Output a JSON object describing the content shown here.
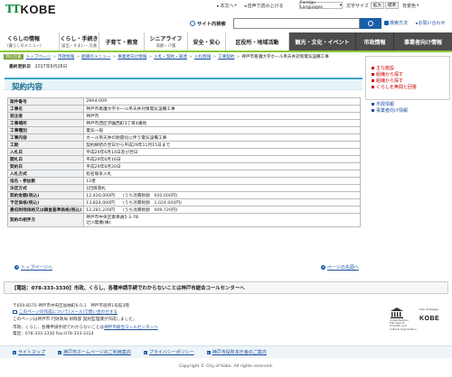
{
  "header": {
    "logo_mark": "TT",
    "logo_word": "KOBE",
    "links": {
      "home": "本文へ",
      "read_aloud": "音声で読み上げる",
      "language": "Foreign Languages",
      "text_size": "文字サイズ",
      "enlarge": "拡大",
      "standard": "標準",
      "bg_color": "背景色"
    },
    "search": {
      "label": "サイト内検索",
      "placeholder": "",
      "help": "検索方法",
      "faq": "お問い合わせ"
    }
  },
  "nav": [
    {
      "l1": "くらしの情報",
      "l2": "(暮らしのメニュー)"
    },
    {
      "l1": "くらし・手続き",
      "l2": "届出・すまい・交通"
    },
    {
      "l1": "子育て・教育",
      "l2": ""
    },
    {
      "l1": "シニアライフ",
      "l2": "高齢・介護"
    },
    {
      "l1": "安全・安心",
      "l2": ""
    },
    {
      "l1": "区役所・地域活動",
      "l2": ""
    },
    {
      "l1": "観光・文化・イベント",
      "l2": ""
    },
    {
      "l1": "市政情報",
      "l2": ""
    },
    {
      "l1": "事業者向け情報",
      "l2": ""
    }
  ],
  "breadcrumb": {
    "here": "現在位置",
    "items": [
      "トップページ",
      "市政情報",
      "組織のメニュー",
      "事業者向け情報",
      "入札・契約・調達",
      "入札情報",
      "工事契約",
      "神戸市看護大学ホール吊天井改修工事"
    ],
    "current": "神戸市看護大学ホール吊天井対策電気設備工事"
  },
  "updated": {
    "label": "最終更新日",
    "date": "2017年6月28日"
  },
  "page_title": "契約内容",
  "contract": {
    "rows": [
      {
        "key": "案件番号",
        "value": "29A4-009"
      },
      {
        "key": "工事名",
        "value": "神戸市看護大学ホール吊天井対策電気設備工事"
      },
      {
        "key": "発注者",
        "value": "神戸市"
      },
      {
        "key": "工事場所",
        "value": "神戸市西区学園西町3丁目4番地"
      },
      {
        "key": "工事種別",
        "value": "電気一般"
      },
      {
        "key": "工事内容",
        "value": "ホール吊天井の耐震化に伴う電気設備工事"
      },
      {
        "key": "工期",
        "value": "契約締結の翌日から平成29年11月15日まで"
      },
      {
        "key": "入札日",
        "value": "平成29年6月14日及び翌日"
      },
      {
        "key": "開札日",
        "value": "平成29年6月16日"
      },
      {
        "key": "契約日",
        "value": "平成29年6月20日"
      },
      {
        "key": "入札方式",
        "value": "指名競争入札"
      },
      {
        "key": "指名・参加数",
        "value": "12者"
      },
      {
        "key": "決定方式",
        "value": "1回目落札"
      },
      {
        "key": "契約金額(税込)",
        "value": "12,420,000円",
        "sub": "(うち消費税額　920,000円)"
      },
      {
        "key": "予定価格(税込)",
        "value": "13,824,000円",
        "sub": "(うち消費税額　1,024,000円)"
      },
      {
        "key": "最低制限価格又は調査基準価格(税込)",
        "value": "12,281,220円",
        "sub": "(うち消費税額　909,720円)"
      }
    ],
    "contractor_key": "契約の相手方",
    "contractor_addr": "神戸市中央区御幸通5-3-7B",
    "contractor_name": "辻川電機(株)"
  },
  "sidebar": {
    "items": [
      {
        "label": "主な施設",
        "color": "red"
      },
      {
        "label": "組織から探す",
        "color": "red"
      },
      {
        "label": "組織から探す",
        "color": "red"
      },
      {
        "label": "くらしを無間と回答",
        "color": "red"
      },
      {
        "label": "市政情報",
        "color": "blue"
      },
      {
        "label": "事業者向け情報",
        "color": "blue"
      }
    ]
  },
  "bottom_links": {
    "top": "トップページへ",
    "back": "ページの先頭へ"
  },
  "callbar": {
    "text": "【電話：078-333-3330】市政、くらし、各種申請手続でわからないことは神戸市総合コールセンターへ"
  },
  "footer": {
    "address": "〒650-8570 神戸市中央区加納町6-5-1　神戸市役所1号館3階",
    "map_link": "このページの作成について(メール)で問い合わせする",
    "owner": "このページは神戸市 行財政局 財政部 契約監理課が作成しました。",
    "call_pre": "市政、くらし、各種申請手続でわからないことは",
    "call_link": "神戸市総合コールセンターへ",
    "tel": "電話：078-333-3330 Fax:078-333-3314",
    "unesco_text": "United Nations Educational, Scientific and Cultural Organization",
    "unesco_city": "City of Design",
    "unesco_kobe": "KOBE"
  },
  "footnav": [
    "サイトマップ",
    "神戸市ホームページのご利用案内",
    "プライバシーポリシー",
    "神戸市役所本庁舎のご案内"
  ],
  "copyright": "Copyright © City of Kobe. All rights reserved."
}
